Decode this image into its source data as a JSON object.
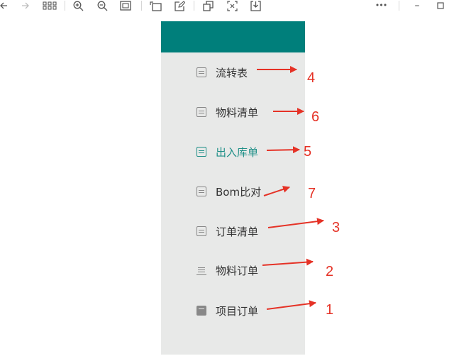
{
  "toolbar": {
    "icons": [
      "back-arrow-icon",
      "forward-arrow-icon",
      "grid-icon",
      "zoom-in-icon",
      "zoom-out-icon",
      "fit-page-icon",
      "rotate-icon",
      "edit-icon",
      "copy-icon",
      "crop-icon",
      "download-icon",
      "more-icon",
      "minimize-icon",
      "maximize-icon"
    ],
    "more_glyph": "•••",
    "minimize_glyph": "–"
  },
  "sidebar": {
    "header_color": "#007f7b",
    "background": "#e8e9e8",
    "items": [
      {
        "label": "流转表",
        "icon": "document-list-icon",
        "active": false
      },
      {
        "label": "物料清单",
        "icon": "clipboard-icon",
        "active": false
      },
      {
        "label": "出入库单",
        "icon": "warehouse-icon",
        "active": true
      },
      {
        "label": "Bom比对",
        "icon": "compare-icon",
        "active": false
      },
      {
        "label": "订单清单",
        "icon": "order-list-icon",
        "active": false
      },
      {
        "label": "物料订单",
        "icon": "cart-icon",
        "active": false
      },
      {
        "label": "项目订单",
        "icon": "box-icon",
        "active": false
      }
    ],
    "active_color": "#1e8f87"
  },
  "annotations": {
    "color": "#e53226",
    "numbers": [
      "4",
      "6",
      "5",
      "7",
      "3",
      "2",
      "1"
    ]
  }
}
